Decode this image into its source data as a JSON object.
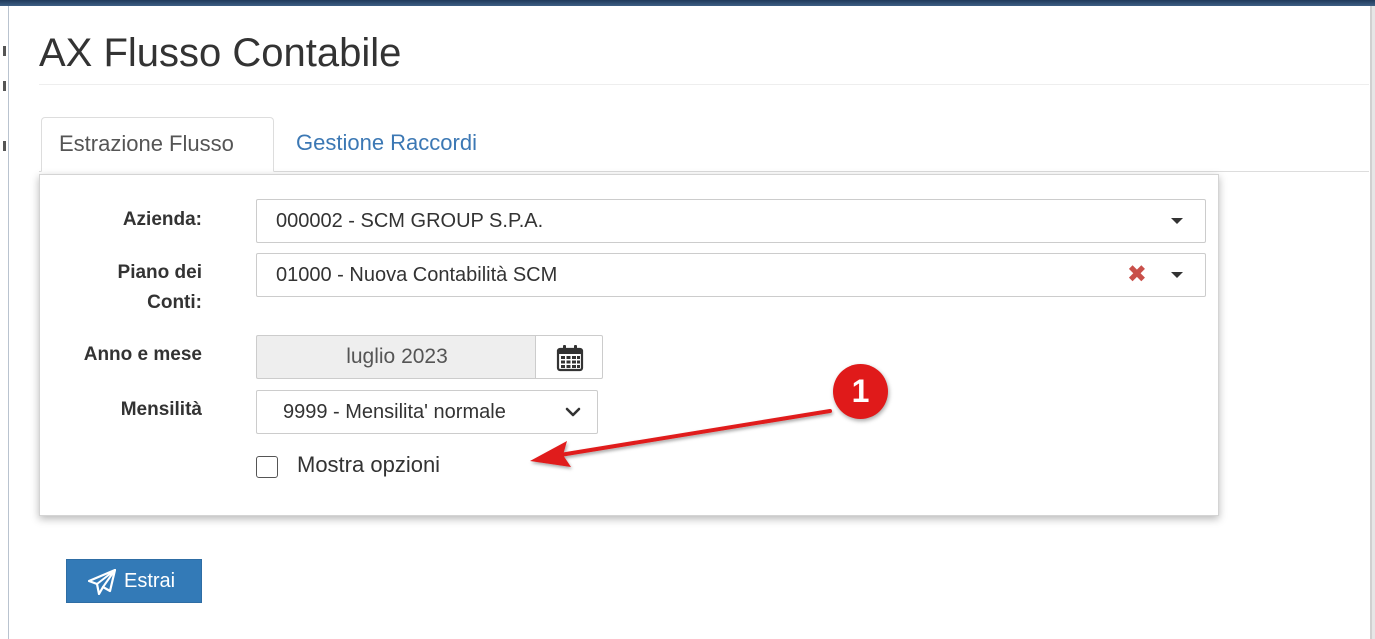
{
  "page": {
    "title": "AX Flusso Contabile"
  },
  "tabs": [
    {
      "label": "Estrazione Flusso",
      "active": true
    },
    {
      "label": "Gestione Raccordi",
      "active": false
    }
  ],
  "form": {
    "azienda": {
      "label": "Azienda:",
      "value": "000002 - SCM GROUP S.P.A."
    },
    "piano_conti": {
      "label_line1": "Piano dei",
      "label_line2": "Conti:",
      "value": "01000 - Nuova Contabilità SCM",
      "clear_icon": "times-icon"
    },
    "anno_mese": {
      "label": "Anno e mese",
      "value": "luglio 2023",
      "icon": "calendar-icon"
    },
    "mensilita": {
      "label": "Mensilità",
      "value": "9999 - Mensilita' normale"
    },
    "mostra_opzioni": {
      "label": "Mostra opzioni",
      "checked": false
    }
  },
  "actions": {
    "estrai_label": "Estrai",
    "estrai_icon": "paper-plane-icon"
  },
  "annotation": {
    "badge_number": "1"
  },
  "colors": {
    "primary": "#337ab7",
    "link": "#3c78b4",
    "annotation_red": "#e01a1a",
    "clear_red": "#c9504a"
  }
}
